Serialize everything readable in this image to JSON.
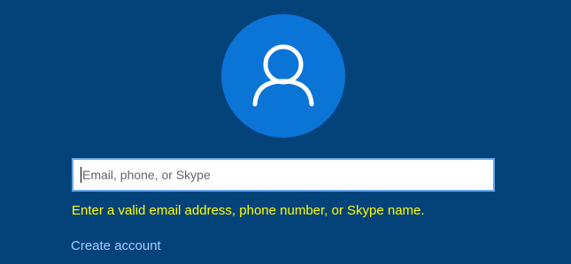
{
  "colors": {
    "background": "#04427a",
    "avatar_circle": "#0b74d7",
    "error_text": "#ffff00",
    "link_text": "#9fd1ff"
  },
  "avatar": {
    "icon": "user-icon"
  },
  "email_input": {
    "placeholder": "Email, phone, or Skype",
    "value": ""
  },
  "error_message": "Enter a valid email address, phone number, or Skype name.",
  "links": {
    "create_account": "Create account"
  }
}
